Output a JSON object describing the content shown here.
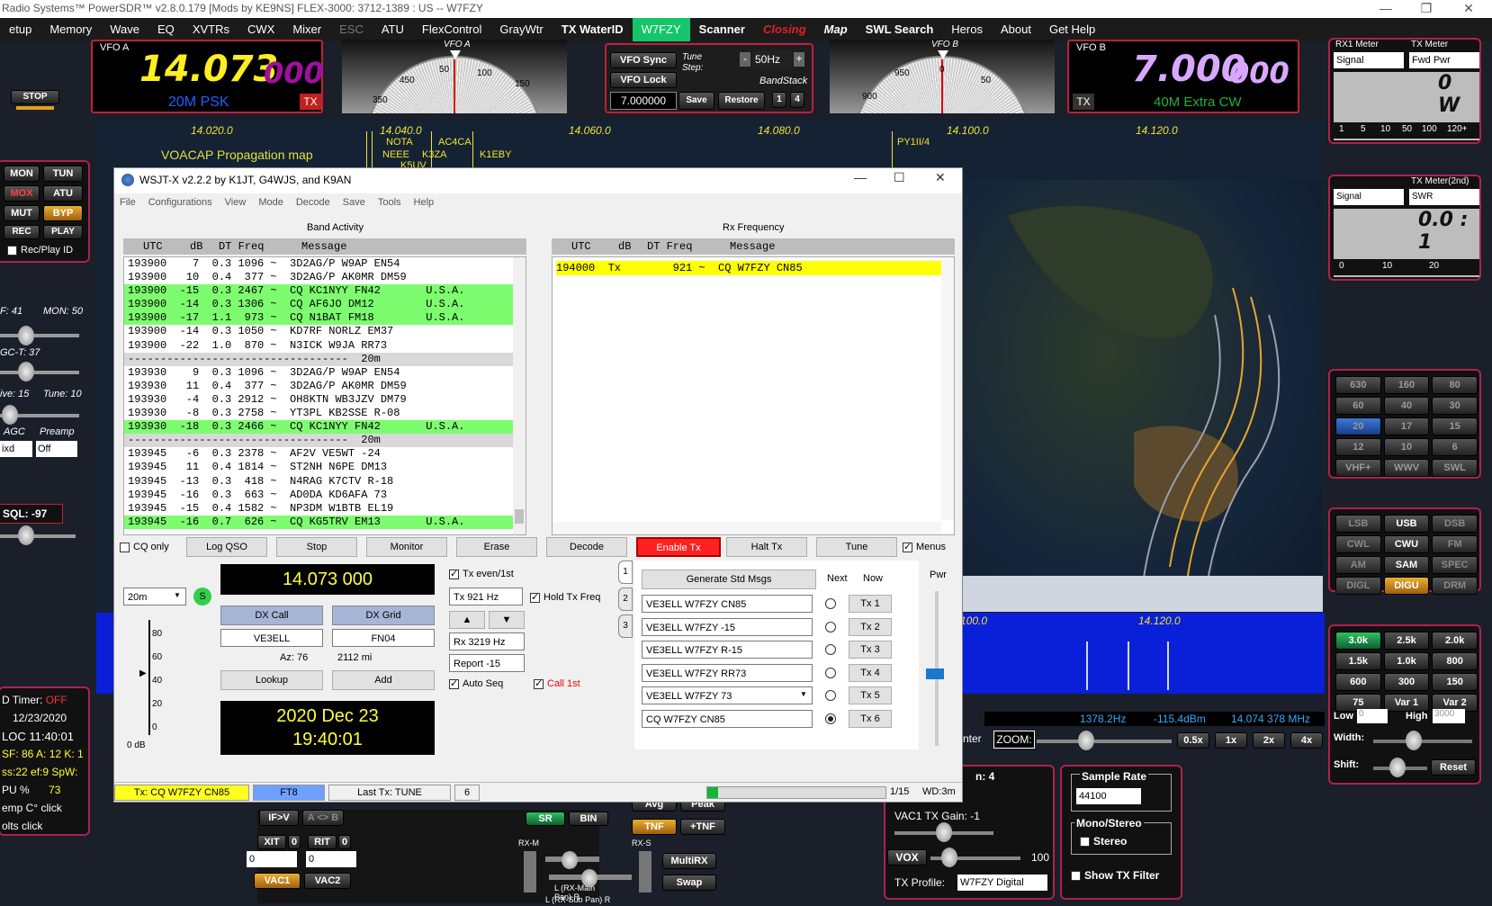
{
  "app": {
    "title": "Radio Systems™ PowerSDR™ v2.8.0.179  [Mods by KE9NS]  FLEX-3000: 3712-1389 : US   --  W7FZY"
  },
  "menu": [
    {
      "label": "etup",
      "cls": ""
    },
    {
      "label": "Memory",
      "cls": ""
    },
    {
      "label": "Wave",
      "cls": ""
    },
    {
      "label": "EQ",
      "cls": ""
    },
    {
      "label": "XVTRs",
      "cls": ""
    },
    {
      "label": "CWX",
      "cls": ""
    },
    {
      "label": "Mixer",
      "cls": ""
    },
    {
      "label": "ESC",
      "cls": "dim"
    },
    {
      "label": "ATU",
      "cls": ""
    },
    {
      "label": "FlexControl",
      "cls": ""
    },
    {
      "label": "GrayWtr",
      "cls": ""
    },
    {
      "label": "TX WaterID",
      "cls": "b"
    },
    {
      "label": "W7FZY",
      "cls": "hl"
    },
    {
      "label": "Scanner",
      "cls": "b"
    },
    {
      "label": "Closing",
      "cls": "cl"
    },
    {
      "label": "Map",
      "cls": "it"
    },
    {
      "label": "SWL Search",
      "cls": "b"
    },
    {
      "label": "Heros",
      "cls": ""
    },
    {
      "label": "About",
      "cls": ""
    },
    {
      "label": "Get Help",
      "cls": ""
    }
  ],
  "vfoa": {
    "label": "VFO A",
    "freq_main": "14.073",
    "freq_sub": "000",
    "band": "20M PSK",
    "tx": "TX"
  },
  "vfob": {
    "label": "VFO B",
    "freq_main": "7.000",
    "freq_sub": "000",
    "band": "40M Extra CW",
    "tx": "TX"
  },
  "dials": {
    "a_label": "VFO A",
    "b_label": "VFO B",
    "a_ticks": [
      "50",
      "100",
      "150",
      "350",
      "450"
    ],
    "b_ticks": [
      "950",
      "0",
      "50",
      "900"
    ]
  },
  "center": {
    "vfo_sync": "VFO Sync",
    "vfo_lock": "VFO Lock",
    "tune_step_label": "Tune Step:",
    "tune_step": "50Hz",
    "minus": "-",
    "plus": "+",
    "bandstack": "BandStack",
    "freq": "7.000000",
    "save": "Save",
    "restore": "Restore",
    "bs1": "1",
    "bs4": "4"
  },
  "stop": "STOP",
  "leftctl": {
    "mon": "MON",
    "tun": "TUN",
    "mox": "MOX",
    "atu": "ATU",
    "mut": "MUT",
    "byp": "BYP",
    "rec": "REC",
    "play": "PLAY",
    "recplay": "Rec/Play ID",
    "af": "F: 41",
    "mon_val": "MON: 50",
    "agct": "GC-T: 37",
    "drive": "ive: 15",
    "tune": "Tune: 10",
    "agc": "AGC",
    "preamp": "Preamp",
    "agc_val": "ixd",
    "preamp_val": "Off",
    "sql": "SQL: -97"
  },
  "leftinfo": {
    "timer": "D Timer:",
    "timer_val": "OFF",
    "date": "12/23/2020",
    "loc": "LOC  11:40:01",
    "sf": "SF: 86 A: 12 K: 1",
    "ss": "ss:22 ef:9 SpW:",
    "cpu": "PU %",
    "cpu_val": "73",
    "temp": "emp C°   click",
    "volts": "olts       click"
  },
  "spectrum": {
    "labels": [
      "14.020.0",
      "14.040.0",
      "14.060.0",
      "14.080.0",
      "14.100.0",
      "14.120.0"
    ],
    "wf_labels": [
      "100.0",
      "14.120.0"
    ],
    "spots": [
      "NOTA",
      "AC4CA",
      "NEEE",
      "K3ZA",
      "K1EBY",
      "K5UV",
      "PY1II/4"
    ],
    "voacap": "VOACAP Propagation map"
  },
  "wfinfo": {
    "hz": "1378.2Hz",
    "dbm": "-115.4dBm",
    "mhz": "14.074 378 MHz",
    "center": "nter",
    "zoom": "ZOOM:",
    "z05": "0.5x",
    "z1": "1x",
    "z2": "2x",
    "z4": "4x"
  },
  "rx1meter": {
    "l1": "RX1 Meter",
    "l2": "TX Meter",
    "sel1": "Signal",
    "sel2": "Fwd Pwr",
    "value": "0 W",
    "scale": [
      "1",
      "5",
      "10",
      "50",
      "100",
      "120+"
    ]
  },
  "txmeter2": {
    "l": "TX Meter(2nd)",
    "sel1": "Signal",
    "sel2": "SWR",
    "value": "0.0 : 1",
    "scale": [
      "0",
      "10",
      "20"
    ]
  },
  "bands": [
    "630",
    "160",
    "80",
    "60",
    "40",
    "30",
    "20",
    "17",
    "15",
    "12",
    "10",
    "6",
    "VHF+",
    "WWV",
    "SWL"
  ],
  "modes": [
    "LSB",
    "USB",
    "DSB",
    "CWL",
    "CWU",
    "FM",
    "AM",
    "SAM",
    "SPEC",
    "DIGL",
    "DIGU",
    "DRM"
  ],
  "filters": [
    "3.0k",
    "2.5k",
    "2.0k",
    "1.5k",
    "1.0k",
    "800",
    "600",
    "300",
    "150",
    "75",
    "Var 1",
    "Var 2"
  ],
  "filterctl": {
    "low": "Low",
    "low_val": "0",
    "high": "High",
    "high_val": "3000",
    "width": "Width:",
    "shift": "Shift:",
    "reset": "Reset"
  },
  "bottom": {
    "ifv": "IF>V",
    "ab": "A <> B",
    "xit": "XIT",
    "xit_n": "0",
    "rit": "RIT",
    "rit_n": "0",
    "xit_val": "0",
    "rit_val": "0",
    "vac1": "VAC1",
    "vac2": "VAC2",
    "sr": "SR",
    "bin": "BIN",
    "avg": "Avg",
    "peak": "Peak",
    "tnf": "TNF",
    "ptnf": "+TNF",
    "multirx": "MultiRX",
    "swap": "Swap",
    "rxm": "RX-M",
    "rxs": "RX-S",
    "lmain": "L (RX-Main Pan) R",
    "lsub": "L (RX-Sub Pan) R",
    "ch4": "n: 4",
    "vac1gain": "VAC1  TX Gain:  -1",
    "vox": "VOX",
    "vox_val": "100",
    "txprofile": "TX Profile:",
    "txprofile_val": "W7FZY Digital",
    "samplerate": "Sample Rate",
    "samplerate_val": "44100",
    "monostereo": "Mono/Stereo",
    "stereo": "Stereo",
    "showtx": "Show TX Filter"
  },
  "wsjt": {
    "title": "WSJT-X   v2.2.2   by K1JT, G4WJS, and K9AN",
    "menus": [
      "File",
      "Configurations",
      "View",
      "Mode",
      "Decode",
      "Save",
      "Tools",
      "Help"
    ],
    "band_activity": "Band Activity",
    "rx_frequency": "Rx Frequency",
    "headers": [
      "UTC",
      "dB",
      "DT Freq",
      "Message"
    ],
    "rows": [
      {
        "t": "193900    7  0.3 1096 ~  3D2AG/P W9AP EN54",
        "s": ""
      },
      {
        "t": "193900   10  0.4  377 ~  3D2AG/P AK0MR DM59",
        "s": ""
      },
      {
        "t": "193900  -15  0.3 2467 ~  CQ KC1NYY FN42       U.S.A.",
        "s": "g"
      },
      {
        "t": "193900  -14  0.3 1306 ~  CQ AF6JO DM12        U.S.A.",
        "s": "g"
      },
      {
        "t": "193900  -17  1.1  973 ~  CQ N1BAT FM18        U.S.A.",
        "s": "g"
      },
      {
        "t": "193900  -14  0.3 1050 ~  KD7RF NORLZ EM37",
        "s": ""
      },
      {
        "t": "193900  -22  1.0  870 ~  N3ICK W9JA RR73",
        "s": ""
      },
      {
        "t": "----------------------------------  20m",
        "s": "sep"
      },
      {
        "t": "193930    9  0.3 1096 ~  3D2AG/P W9AP EN54",
        "s": ""
      },
      {
        "t": "193930   11  0.4  377 ~  3D2AG/P AK0MR DM59",
        "s": ""
      },
      {
        "t": "193930   -4  0.3 2912 ~  OH8KTN WB3JZV DM79",
        "s": ""
      },
      {
        "t": "193930   -8  0.3 2758 ~  YT3PL KB2SSE R-08",
        "s": ""
      },
      {
        "t": "193930  -18  0.3 2466 ~  CQ KC1NYY FN42       U.S.A.",
        "s": "g"
      },
      {
        "t": "----------------------------------  20m",
        "s": "sep"
      },
      {
        "t": "193945   -6  0.3 2378 ~  AF2V VE5WT -24",
        "s": ""
      },
      {
        "t": "193945   11  0.4 1814 ~  ST2NH N6PE DM13",
        "s": ""
      },
      {
        "t": "193945  -13  0.3  418 ~  N4RAG K7CTV R-18",
        "s": ""
      },
      {
        "t": "193945  -16  0.3  663 ~  AD0DA KD6AFA 73",
        "s": ""
      },
      {
        "t": "193945  -15  0.4 1582 ~  NP3DM W1BTB EL19",
        "s": ""
      },
      {
        "t": "193945  -16  0.7  626 ~  CQ KG5TRV EM13       U.S.A.",
        "s": "g"
      }
    ],
    "rx_row": "194000  Tx        921 ~  CQ W7FZY CN85",
    "buttons": {
      "cqonly": "CQ only",
      "logqso": "Log QSO",
      "stop": "Stop",
      "monitor": "Monitor",
      "erase": "Erase",
      "decode": "Decode",
      "enabletx": "Enable Tx",
      "halttx": "Halt Tx",
      "tune": "Tune",
      "menus": "Menus"
    },
    "band": "20m",
    "dial_freq": "14.073 000",
    "dxcall_lbl": "DX Call",
    "dxgrid_lbl": "DX Grid",
    "dxcall": "VE3ELL",
    "dxgrid": "FN04",
    "az": "Az: 76",
    "dist": "2112 mi",
    "lookup": "Lookup",
    "add": "Add",
    "date": "2020 Dec 23",
    "time": "19:40:01",
    "txeven": "Tx even/1st",
    "txfreq": "Tx  921  Hz",
    "holdtx": "Hold Tx Freq",
    "rxfreq": "Rx  3219  Hz",
    "report": "Report -15",
    "autoseq": "Auto Seq",
    "call1st": "Call 1st",
    "tabs": [
      "1",
      "2",
      "3"
    ],
    "gen": "Generate Std Msgs",
    "next": "Next",
    "now": "Now",
    "pwr": "Pwr",
    "msgs": [
      "VE3ELL W7FZY CN85",
      "VE3ELL W7FZY -15",
      "VE3ELL W7FZY R-15",
      "VE3ELL W7FZY RR73",
      "VE3ELL W7FZY 73",
      "CQ W7FZY CN85"
    ],
    "txbtns": [
      "Tx 1",
      "Tx 2",
      "Tx 3",
      "Tx 4",
      "Tx 5",
      "Tx 6"
    ],
    "scale": [
      "80",
      "60",
      "40",
      "20",
      "0"
    ],
    "db": "0 dB",
    "status_tx": "Tx: CQ W7FZY CN85",
    "status_mode": "FT8",
    "status_last": "Last Tx: TUNE",
    "status_n": "6",
    "status_page": "1/15",
    "status_wd": "WD:3m"
  }
}
